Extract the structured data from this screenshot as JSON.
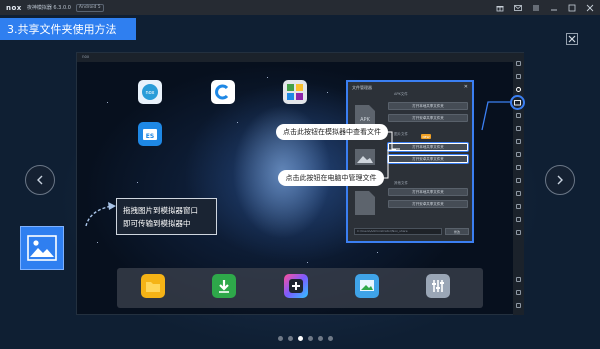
{
  "titlebar": {
    "logo": "nox",
    "title": "夜神模拟器 6.3.0.0",
    "badge": "Android 5"
  },
  "banner": {
    "text": "3.共享文件夹使用方法"
  },
  "screen": {
    "topbar_text": "nox"
  },
  "dialog": {
    "title": "文件管理器",
    "close": "✕",
    "section1": "APK文件",
    "section1_btn1": "打开本地共享文件夹",
    "section1_btn2": "打开安卓共享文件夹",
    "apk_label": "APK",
    "section2": "图片文件",
    "section2_badge": "NEW",
    "section2_btn1": "打开本地共享文件夹",
    "section2_btn2": "打开安卓共享文件夹",
    "section3": "其他文件",
    "section3_btn1": "打开本地共享文件夹",
    "section3_btn2": "打开安卓共享文件夹",
    "path_text": "C:\\Users\\Administrator\\Nox_share",
    "browse_label": "修改"
  },
  "callouts": {
    "view_in_emulator": "点击此按钮在模拟器中查看文件",
    "manage_on_pc": "点击此按钮在电脑中管理文件"
  },
  "hint": {
    "line1": "拖拽图片到模拟器窗口",
    "line2": "即可传输到模拟器中"
  },
  "desktop_icons": [
    "nox-helper-icon",
    "c-app-icon",
    "toolbox-icon",
    "es-file-explorer-icon"
  ],
  "dock_icons": [
    "folder-icon",
    "download-icon",
    "add-app-icon",
    "gallery-icon",
    "settings-icon"
  ],
  "pagination": {
    "count": 6,
    "active": 3
  },
  "colors": {
    "accent": "#2f7ff0",
    "dialog_border": "#3b7ff2"
  }
}
